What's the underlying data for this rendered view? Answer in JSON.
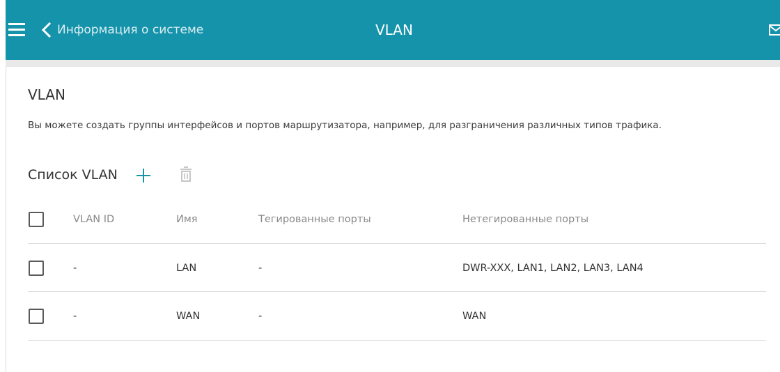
{
  "header": {
    "back_label": "Информация о системе",
    "title": "VLAN"
  },
  "section": {
    "title": "VLAN",
    "description": "Вы можете создать группы интерфейсов и портов маршрутизатора, например, для разграничения различных типов трафика."
  },
  "list": {
    "title": "Список VLAN"
  },
  "table": {
    "columns": [
      "VLAN ID",
      "Имя",
      "Тегированные порты",
      "Нетегированные порты"
    ],
    "rows": [
      {
        "vlan_id": "-",
        "name": "LAN",
        "tagged": "-",
        "untagged": "DWR-XXX, LAN1, LAN2, LAN3, LAN4"
      },
      {
        "vlan_id": "-",
        "name": "WAN",
        "tagged": "-",
        "untagged": "WAN"
      }
    ]
  },
  "colors": {
    "header_bg": "#1593aa",
    "accent": "#1593aa",
    "divider": "#dddddd"
  },
  "icons": {
    "menu": "menu-icon",
    "back": "chevron-left-icon",
    "mail": "mail-icon",
    "add": "plus-icon",
    "delete": "trash-icon"
  }
}
